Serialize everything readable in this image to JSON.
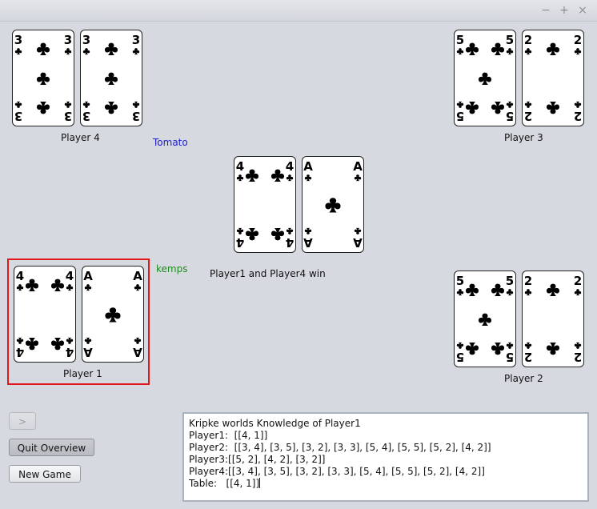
{
  "window": {
    "minimize_glyph": "−",
    "maximize_glyph": "+",
    "close_glyph": "×"
  },
  "players": {
    "p4": {
      "label": "Player 4",
      "cards": [
        {
          "rank": "3",
          "suit": "clubs"
        },
        {
          "rank": "3",
          "suit": "clubs"
        }
      ]
    },
    "p3": {
      "label": "Player 3",
      "cards": [
        {
          "rank": "5",
          "suit": "clubs"
        },
        {
          "rank": "2",
          "suit": "clubs"
        }
      ]
    },
    "p1": {
      "label": "Player 1",
      "cards": [
        {
          "rank": "4",
          "suit": "clubs"
        },
        {
          "rank": "A",
          "suit": "clubs"
        }
      ]
    },
    "p2": {
      "label": "Player 2",
      "cards": [
        {
          "rank": "5",
          "suit": "clubs"
        },
        {
          "rank": "2",
          "suit": "clubs"
        }
      ]
    }
  },
  "table": {
    "cards": [
      {
        "rank": "4",
        "suit": "clubs"
      },
      {
        "rank": "A",
        "suit": "clubs"
      }
    ]
  },
  "names": {
    "tomato": {
      "text": "Tomato",
      "color": "#1c1ccc"
    },
    "kemps": {
      "text": "kemps",
      "color": "#1f8a1f"
    }
  },
  "status": "Player1  and  Player4 win",
  "buttons": {
    "next": ">",
    "quit_overview": "Quit Overview",
    "new_game": "New Game"
  },
  "knowledge": {
    "title": "Kripke worlds Knowledge of Player1",
    "lines": [
      "Player1:  [[4, 1]]",
      "Player2:  [[3, 4], [3, 5], [3, 2], [3, 3], [5, 4], [5, 5], [5, 2], [4, 2]]",
      "Player3:[[5, 2], [4, 2], [3, 2]]",
      "Player4:[[3, 4], [3, 5], [3, 2], [3, 3], [5, 4], [5, 5], [5, 2], [4, 2]]",
      "Table:   [[4, 1]]"
    ]
  }
}
